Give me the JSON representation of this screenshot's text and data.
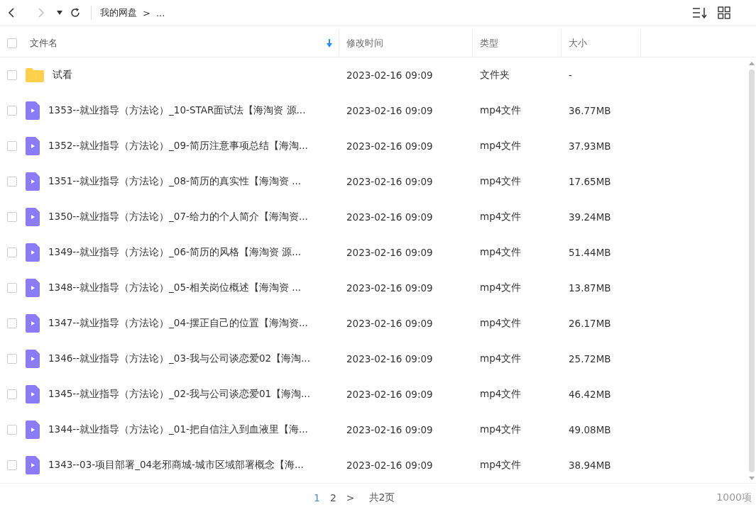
{
  "breadcrumb": [
    "我的网盘",
    ">",
    "..."
  ],
  "table": {
    "select_all": {
      "checked": false
    },
    "columns": [
      {
        "label": "文件名",
        "sorted": true
      },
      {
        "label": "修改时间",
        "sorted": false
      },
      {
        "label": "类型",
        "sorted": false
      },
      {
        "label": "大小",
        "sorted": false
      }
    ],
    "rows": [
      {
        "kind": "folder",
        "checked": false,
        "name": "试看",
        "modified": "2023-02-16 09:09",
        "type": "文件夹",
        "size": "-"
      },
      {
        "kind": "video",
        "checked": false,
        "name": "1353--就业指导（方法论）_10-STAR面试法【海淘资 源...",
        "modified": "2023-02-16 09:09",
        "type": "mp4文件",
        "size": "36.77MB"
      },
      {
        "kind": "video",
        "checked": false,
        "name": "1352--就业指导（方法论）_09-简历注意事项总结【海淘...",
        "modified": "2023-02-16 09:09",
        "type": "mp4文件",
        "size": "37.93MB"
      },
      {
        "kind": "video",
        "checked": false,
        "name": "1351--就业指导（方法论）_08-简历的真实性【海淘资 ...",
        "modified": "2023-02-16 09:09",
        "type": "mp4文件",
        "size": "17.65MB"
      },
      {
        "kind": "video",
        "checked": false,
        "name": "1350--就业指导（方法论）_07-给力的个人简介【海淘资...",
        "modified": "2023-02-16 09:09",
        "type": "mp4文件",
        "size": "39.24MB"
      },
      {
        "kind": "video",
        "checked": false,
        "name": "1349--就业指导（方法论）_06-简历的风格【海淘资 源...",
        "modified": "2023-02-16 09:09",
        "type": "mp4文件",
        "size": "51.44MB"
      },
      {
        "kind": "video",
        "checked": false,
        "name": "1348--就业指导（方法论）_05-相关岗位概述【海淘资 ...",
        "modified": "2023-02-16 09:09",
        "type": "mp4文件",
        "size": "13.87MB"
      },
      {
        "kind": "video",
        "checked": false,
        "name": "1347--就业指导（方法论）_04-摆正自己的位置【海淘资...",
        "modified": "2023-02-16 09:09",
        "type": "mp4文件",
        "size": "26.17MB"
      },
      {
        "kind": "video",
        "checked": false,
        "name": "1346--就业指导（方法论）_03-我与公司谈恋爱02【海淘...",
        "modified": "2023-02-16 09:09",
        "type": "mp4文件",
        "size": "25.72MB"
      },
      {
        "kind": "video",
        "checked": false,
        "name": "1345--就业指导（方法论）_02-我与公司谈恋爱01【海淘...",
        "modified": "2023-02-16 09:09",
        "type": "mp4文件",
        "size": "46.42MB"
      },
      {
        "kind": "video",
        "checked": false,
        "name": "1344--就业指导（方法论）_01-把自信注入到血液里【海...",
        "modified": "2023-02-16 09:09",
        "type": "mp4文件",
        "size": "49.08MB"
      },
      {
        "kind": "video",
        "checked": false,
        "name": "1343--03-项目部署_04老邪商城-城市区域部署概念【海...",
        "modified": "2023-02-16 09:09",
        "type": "mp4文件",
        "size": "38.94MB"
      }
    ]
  },
  "pagination": {
    "pages": [
      {
        "label": "1",
        "selected": true
      },
      {
        "label": "2",
        "selected": false
      }
    ],
    "next": ">",
    "total_pages": "共2页"
  },
  "item_count": "1000项"
}
